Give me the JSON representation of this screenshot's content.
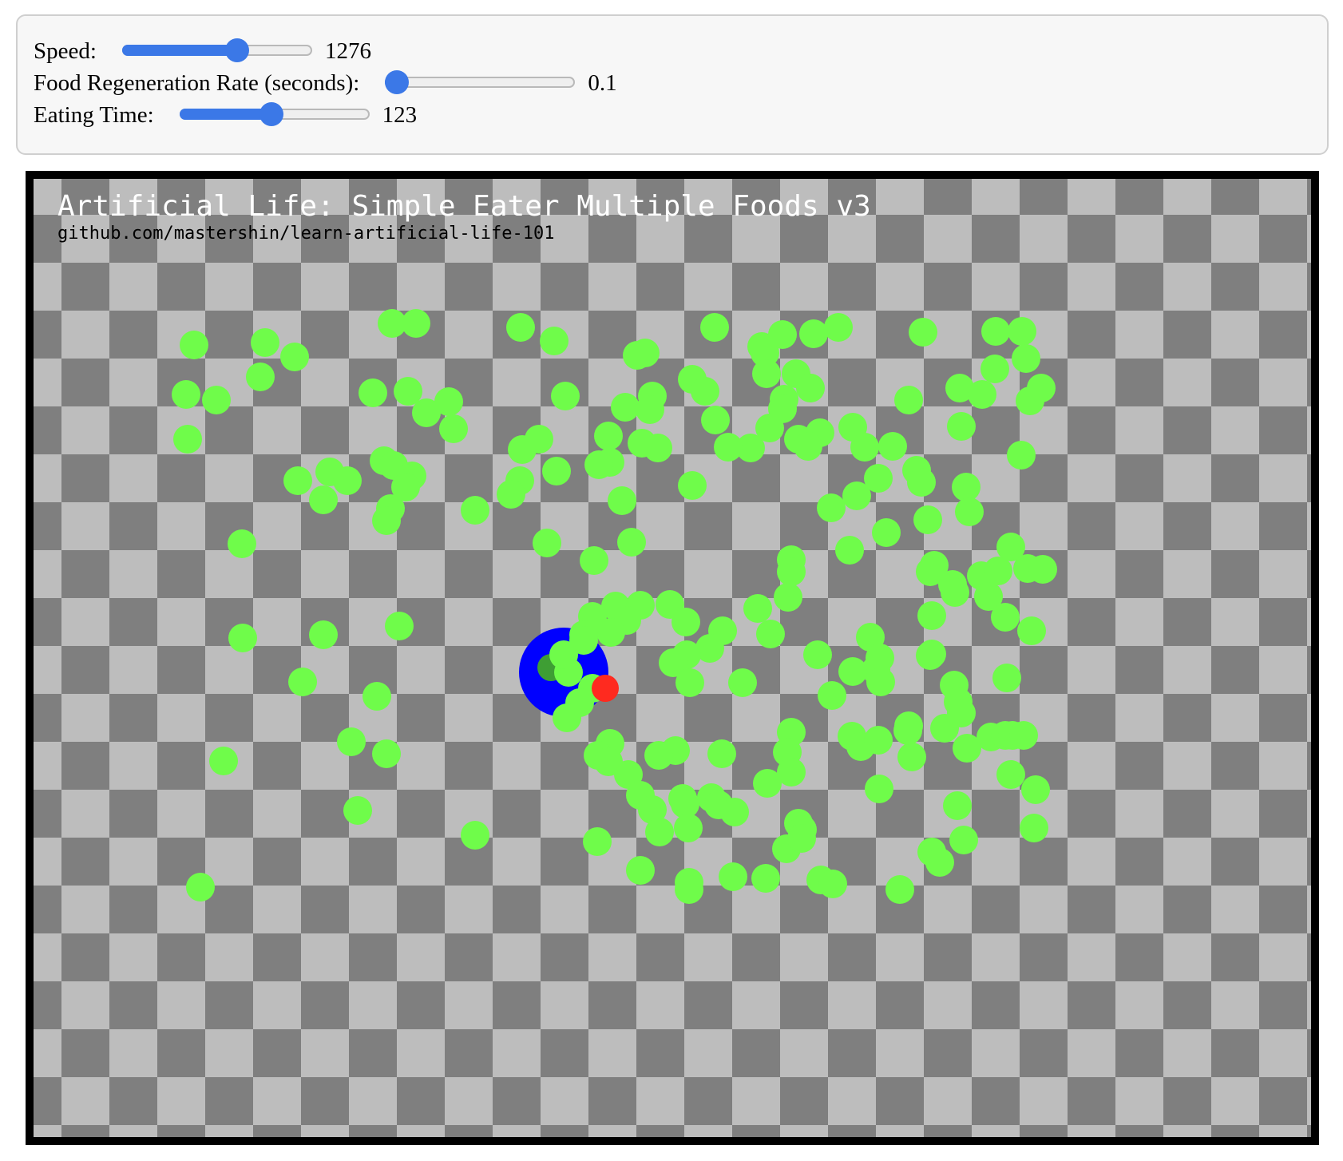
{
  "controls": {
    "speed": {
      "label": "Speed:",
      "value": "1276",
      "fraction": 0.62
    },
    "food_regen": {
      "label": "Food Regeneration Rate (seconds):",
      "value": "0.1",
      "fraction": 0.0
    },
    "eating_time": {
      "label": "Eating Time:",
      "value": "123",
      "fraction": 0.48
    }
  },
  "simulation": {
    "title": "Artificial Life: Simple Eater Multiple Foods v3",
    "subtitle": "github.com/mastershin/learn-artificial-life-101",
    "colors": {
      "checker_light": "#bdbdbd",
      "checker_dark": "#7f7f7f",
      "food": "#6ffc4a",
      "eater_body": "#0000ff",
      "eater_eaten": "#3e9e34",
      "eater_mouth": "#ff2a1f",
      "slider_accent": "#3b78e7"
    }
  }
}
